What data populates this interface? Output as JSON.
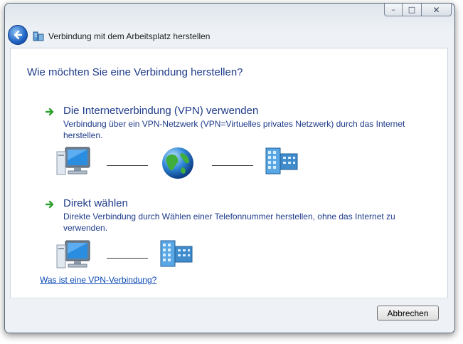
{
  "window": {
    "title": "Verbindung mit dem Arbeitsplatz herstellen",
    "caption_buttons": {
      "minimize": "–",
      "maximize": "□",
      "close": "✕"
    }
  },
  "main": {
    "heading": "Wie möchten Sie eine Verbindung herstellen?",
    "options": [
      {
        "title": "Die Internetverbindung (VPN) verwenden",
        "description": "Verbindung über ein VPN-Netzwerk (VPN=Virtuelles privates Netzwerk) durch das Internet herstellen.",
        "diagram": [
          "computer-icon",
          "globe-icon",
          "workplace-building-icon"
        ]
      },
      {
        "title": "Direkt wählen",
        "description": "Direkte Verbindung durch Wählen einer Telefonnummer herstellen, ohne das Internet zu verwenden.",
        "diagram": [
          "computer-icon",
          "workplace-building-icon"
        ]
      }
    ],
    "help_link": "Was ist eine VPN-Verbindung?"
  },
  "footer": {
    "cancel_label": "Abbrechen"
  },
  "colors": {
    "heading": "#1e3b8a",
    "link": "#0a49b5",
    "arrow": "#2ea02e"
  }
}
